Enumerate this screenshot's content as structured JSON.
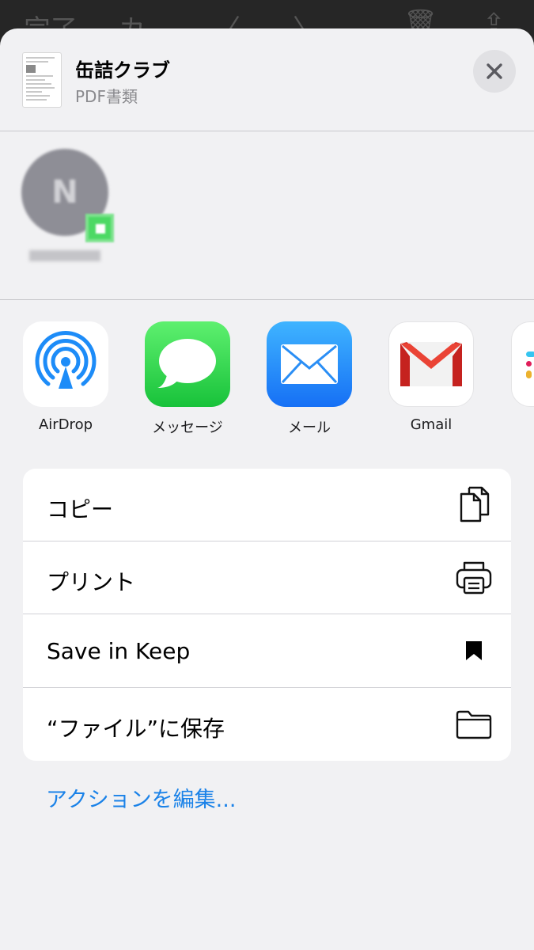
{
  "background_toolbar": {
    "items": [
      "完了",
      "カ",
      "〈",
      "〉",
      "🗑",
      "⇪"
    ]
  },
  "header": {
    "title": "缶詰クラブ",
    "subtitle": "PDF書類"
  },
  "apps": [
    {
      "label": "AirDrop",
      "icon": "airdrop-icon"
    },
    {
      "label": "メッセージ",
      "icon": "messages-icon"
    },
    {
      "label": "メール",
      "icon": "mail-icon"
    },
    {
      "label": "Gmail",
      "icon": "gmail-icon"
    },
    {
      "label": "",
      "icon": "slack-icon"
    }
  ],
  "actions": [
    {
      "label": "コピー",
      "icon": "copy-icon"
    },
    {
      "label": "プリント",
      "icon": "printer-icon"
    },
    {
      "label": "Save in Keep",
      "icon": "bookmark-icon"
    },
    {
      "label": "“ファイル”に保存",
      "icon": "folder-icon"
    }
  ],
  "edit_actions_label": "アクションを編集...",
  "colors": {
    "sheet_bg": "#f1f1f3",
    "link_blue": "#1a82e8",
    "messages_green": "#34c759",
    "mail_blue": "#1d8cf8",
    "gmail_red": "#d93025"
  }
}
